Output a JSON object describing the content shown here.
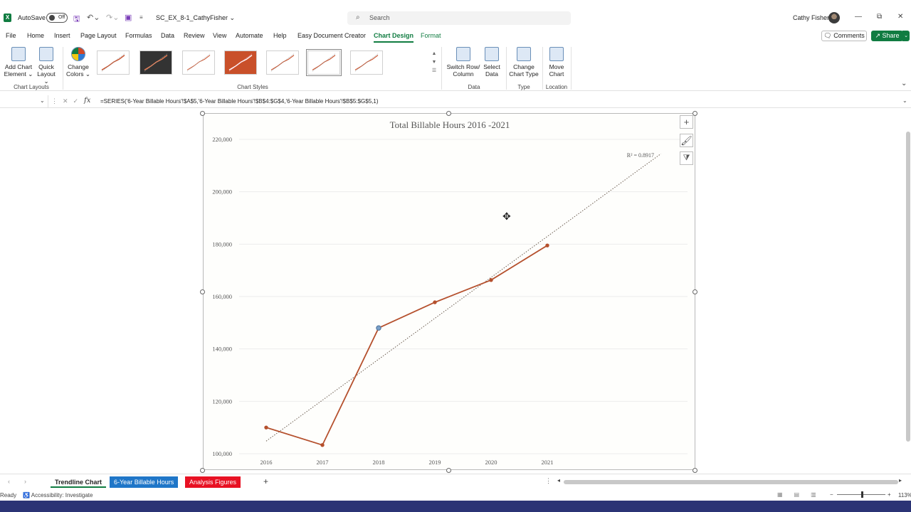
{
  "titlebar": {
    "autosave_label": "AutoSave",
    "autosave_state": "Off",
    "filename": "SC_EX_8-1_CathyFisher ⌄",
    "search_placeholder": "Search",
    "user_name": "Cathy Fisher"
  },
  "menu": {
    "tabs": [
      "File",
      "Home",
      "Insert",
      "Page Layout",
      "Formulas",
      "Data",
      "Review",
      "View",
      "Automate",
      "Help",
      "Easy Document Creator",
      "Chart Design",
      "Format"
    ],
    "active_tab": "Chart Design",
    "comments_label": "Comments",
    "share_label": "Share"
  },
  "ribbon": {
    "add_chart_element": [
      "Add Chart",
      "Element ⌄"
    ],
    "quick_layout": [
      "Quick",
      "Layout ⌄"
    ],
    "change_colors": [
      "Change",
      "Colors ⌄"
    ],
    "switch_row_column": [
      "Switch Row/",
      "Column"
    ],
    "select_data": [
      "Select",
      "Data"
    ],
    "change_chart_type": [
      "Change",
      "Chart Type"
    ],
    "move_chart": [
      "Move",
      "Chart"
    ],
    "groups": {
      "chart_layouts": "Chart Layouts",
      "chart_styles": "Chart Styles",
      "data": "Data",
      "type": "Type",
      "location": "Location"
    }
  },
  "formula_bar": {
    "fx": "fx",
    "formula": "=SERIES('6-Year Billable Hours'!$A$5,'6-Year Billable Hours'!$B$4:$G$4,'6-Year Billable Hours'!$B$5:$G$5,1)"
  },
  "chart_data": {
    "type": "line",
    "title": "Total Billable Hours 2016 -2021",
    "categories": [
      "2016",
      "2017",
      "2018",
      "2019",
      "2020",
      "2021"
    ],
    "series": [
      {
        "values": [
          110000,
          103300,
          148000,
          157800,
          166300,
          179500
        ],
        "color": "#b5502d"
      }
    ],
    "trendline": {
      "type": "linear",
      "start": [
        2016,
        104800
      ],
      "end": [
        2021,
        214500
      ],
      "label": "R² = 0.8917",
      "color": "#6b5d50"
    },
    "ylim": [
      100000,
      220000
    ],
    "yticks": [
      "220,000",
      "200,000",
      "180,000",
      "160,000",
      "140,000",
      "120,000",
      "100,000"
    ],
    "grid": true,
    "selected_point": "2018"
  },
  "sheet_tabs": {
    "tabs": [
      {
        "label": "Trendline Chart",
        "style": "active"
      },
      {
        "label": "6-Year Billable Hours",
        "style": "blue"
      },
      {
        "label": "Analysis Figures",
        "style": "red"
      }
    ],
    "add_label": "+"
  },
  "status": {
    "ready": "Ready",
    "accessibility": "Accessibility: Investigate",
    "zoom": "113%"
  },
  "colors": {
    "accent": "#107c41",
    "series": "#b5502d",
    "tab_blue": "#1f76c8",
    "tab_red": "#e81123",
    "taskbar": "#2b3475"
  }
}
